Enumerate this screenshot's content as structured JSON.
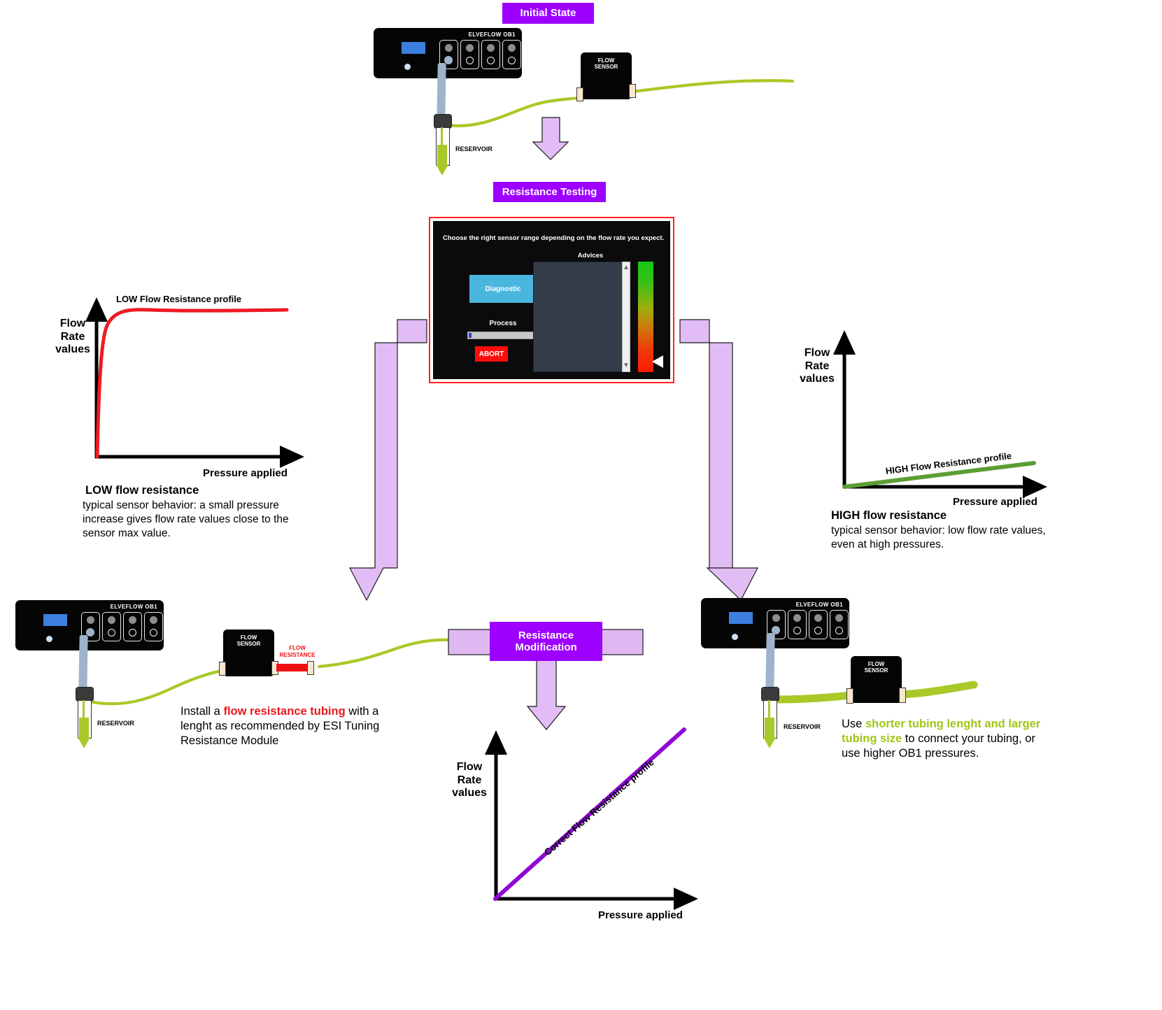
{
  "stages": {
    "initial": "Initial State",
    "testing": "Resistance Testing",
    "modification": "Resistance Modification"
  },
  "device": {
    "name": "ELVEFLOW OB1",
    "sensor_line1": "FLOW",
    "sensor_line2": "SENSOR",
    "reservoir": "RESERVOIR",
    "resistance_line1": "FLOW",
    "resistance_line2": "RESISTANCE"
  },
  "dialog": {
    "heading": "Choose the right sensor range depending on the flow rate you expect.",
    "advices_label": "Advices",
    "diagnostic_button": "Diagnostic",
    "process_label": "Process",
    "abort_button": "ABORT",
    "progress_percent": 4,
    "accent_red": "#ff2020",
    "accent_blue": "#4bb6dd"
  },
  "charts": {
    "low": {
      "profile_label": "LOW Flow Resistance profile",
      "y_label": "Flow\nRate\nvalues",
      "x_label": "Pressure applied",
      "color": "#ee1b24",
      "desc_title": "LOW flow resistance",
      "desc_body": " typical sensor behavior: a small pressure increase gives flow rate values close to the sensor max value."
    },
    "high": {
      "profile_label": "HIGH Flow Resistance profile",
      "y_label": "Flow\nRate\nvalues",
      "x_label": "Pressure applied",
      "color": "#5a9e34",
      "desc_title": "HIGH flow resistance",
      "desc_body": "typical sensor behavior: low flow rate values, even at high pressures."
    },
    "correct": {
      "profile_label": "Correct Flow Resistance profile",
      "y_label": "Flow\nRate\nvalues",
      "x_label": "Pressure applied",
      "color": "#8f09d6"
    }
  },
  "advice_left": {
    "pre": "Install a ",
    "highlight": "flow resistance tubing",
    "post": " with a lenght as recommended by ESI Tuning Resistance Module"
  },
  "advice_right": {
    "pre": "Use ",
    "highlight": "shorter tubing lenght and larger tubing size",
    "post": " to connect your tubing, or use higher OB1 pressures."
  },
  "chart_data": [
    {
      "type": "line",
      "title": "LOW Flow Resistance profile",
      "xlabel": "Pressure applied",
      "ylabel": "Flow Rate values",
      "color": "#ee1b24",
      "x": [
        0,
        1,
        2,
        3,
        5,
        8,
        12,
        20,
        40,
        60,
        80,
        100
      ],
      "y": [
        0,
        55,
        78,
        88,
        93,
        95,
        96,
        96.5,
        97,
        97.2,
        97.4,
        97.5
      ],
      "xlim": [
        0,
        100
      ],
      "ylim": [
        0,
        100
      ],
      "grid": false,
      "legend": "none"
    },
    {
      "type": "line",
      "title": "HIGH Flow Resistance profile",
      "xlabel": "Pressure applied",
      "ylabel": "Flow Rate values",
      "color": "#5a9e34",
      "x": [
        0,
        25,
        50,
        75,
        100
      ],
      "y": [
        0,
        2.5,
        5,
        7.5,
        10
      ],
      "xlim": [
        0,
        100
      ],
      "ylim": [
        0,
        100
      ],
      "grid": false,
      "legend": "none"
    },
    {
      "type": "line",
      "title": "Correct Flow Resistance profile",
      "xlabel": "Pressure applied",
      "ylabel": "Flow Rate values",
      "color": "#8f09d6",
      "x": [
        0,
        25,
        50,
        75,
        100
      ],
      "y": [
        0,
        25,
        50,
        75,
        100
      ],
      "xlim": [
        0,
        100
      ],
      "ylim": [
        0,
        100
      ],
      "grid": false,
      "legend": "none"
    }
  ]
}
